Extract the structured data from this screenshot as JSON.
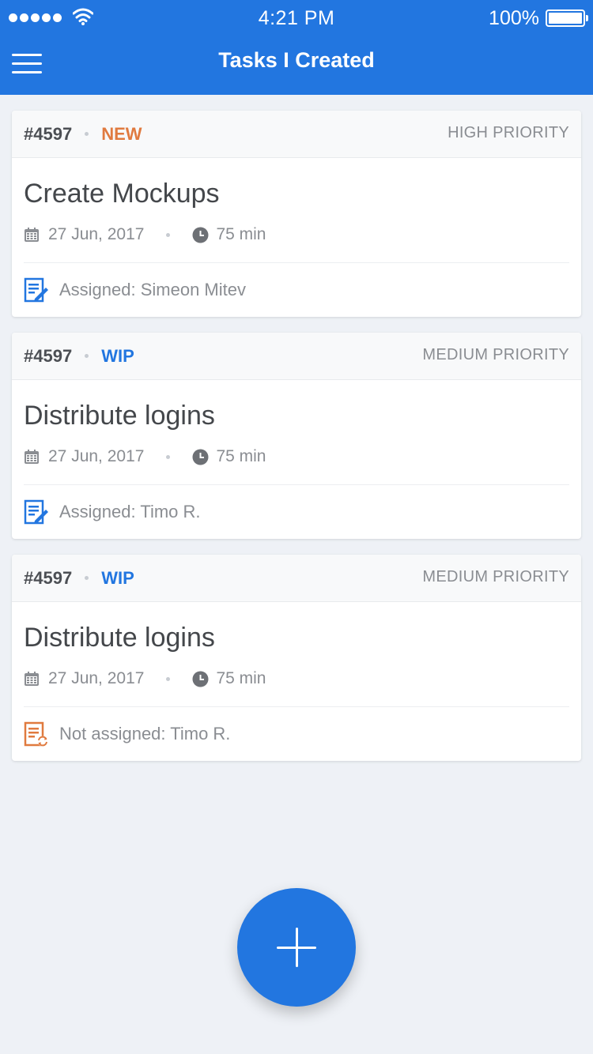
{
  "status_bar": {
    "time": "4:21 PM",
    "battery_text": "100%",
    "icons": [
      "signal-dots-icon",
      "wifi-icon",
      "battery-icon"
    ]
  },
  "header": {
    "title": "Tasks I Created",
    "menu_icon": "hamburger-menu-icon"
  },
  "colors": {
    "accent": "#2276e0",
    "status_new": "#e07a3f",
    "status_wip": "#2276e0",
    "background": "#eef1f6"
  },
  "tasks": [
    {
      "number": "#4597",
      "status": "NEW",
      "priority": "HIGH PRIORITY",
      "title": "Create Mockups",
      "date": "27 Jun, 2017",
      "duration": "75 min",
      "assignment": "Assigned: Simeon Mitev",
      "assignment_icon": "assigned-doc-icon"
    },
    {
      "number": "#4597",
      "status": "WIP",
      "priority": "MEDIUM PRIORITY",
      "title": "Distribute logins",
      "date": "27 Jun, 2017",
      "duration": "75 min",
      "assignment": "Assigned: Timo R.",
      "assignment_icon": "assigned-doc-icon"
    },
    {
      "number": "#4597",
      "status": "WIP",
      "priority": "MEDIUM PRIORITY",
      "title": "Distribute logins",
      "date": "27 Jun, 2017",
      "duration": "75 min",
      "assignment": "Not assigned: Timo R.",
      "assignment_icon": "not-assigned-doc-icon"
    }
  ],
  "fab": {
    "icon": "plus-icon"
  }
}
